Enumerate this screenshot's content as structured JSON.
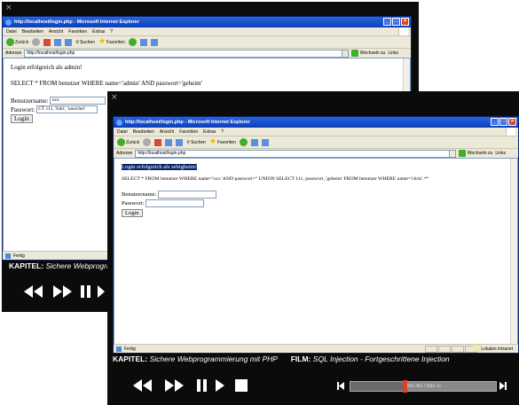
{
  "back_player": {
    "ie": {
      "title": "http://localhost/login.php - Microsoft Internet Explorer",
      "menu": [
        "Datei",
        "Bearbeiten",
        "Ansicht",
        "Favoriten",
        "Extras",
        "?"
      ],
      "toolbar": {
        "back": "Zurück",
        "search": "Suchen",
        "favorites": "Favoriten"
      },
      "address_label": "Adresse",
      "address_value": "http://localhost/login.php",
      "go_label": "Wechseln zu",
      "links_label": "Links"
    },
    "page": {
      "login_message": "Login erfolgreich als admin!",
      "query": "SELECT * FROM benutzer WHERE name='admin' AND passwort='geheim'",
      "username_label": "Benutzername:",
      "username_value": "xxx",
      "password_label": "Passwort:",
      "password_value": "CT 111, 'fobi', 'unsicher'",
      "login_button": "Login"
    },
    "status": "Fertig",
    "chapter_label": "KAPITEL:",
    "chapter_title": "Sichere Webprogrammi"
  },
  "front_player": {
    "ie": {
      "title": "http://localhost/login.php - Microsoft Internet Explorer",
      "menu": [
        "Datei",
        "Bearbeiten",
        "Ansicht",
        "Favoriten",
        "Extras",
        "?"
      ],
      "toolbar": {
        "back": "Zurück",
        "search": "Suchen",
        "favorites": "Favoriten"
      },
      "address_label": "Adresse",
      "address_value": "http://localhost/login.php",
      "go_label": "Wechseln zu",
      "links_label": "Links"
    },
    "page": {
      "login_message": "Login erfolgreich als sebigheim!",
      "query": "SELECT * FROM benutzer WHERE name='xxx' AND passwort='' UNION SELECT 111, passwort, 'geheim' FROM benutzer WHERE name='chris' /*'",
      "username_label": "Benutzername:",
      "password_label": "Passwort:",
      "login_button": "Login"
    },
    "status": "Fertig",
    "zone": "Lokales Intranet",
    "chapter_label": "KAPITEL:",
    "chapter_title": "Sichere Webprogrammierung mit PHP",
    "film_label": "FILM:",
    "film_title": "SQL Injection - Fortgeschrittene Injection",
    "progress_text": "00m 46s / 09m 1s",
    "progress": 0.37
  },
  "colors": {
    "player_bg": "#0b0b0b",
    "knob": "#e33c2a",
    "title_bar": "#0a3fb8"
  },
  "icons": [
    "rewind-icon",
    "fast-forward-icon",
    "pause-icon",
    "play-icon",
    "stop-icon",
    "skip-back-icon",
    "skip-forward-icon",
    "cup-icon"
  ]
}
